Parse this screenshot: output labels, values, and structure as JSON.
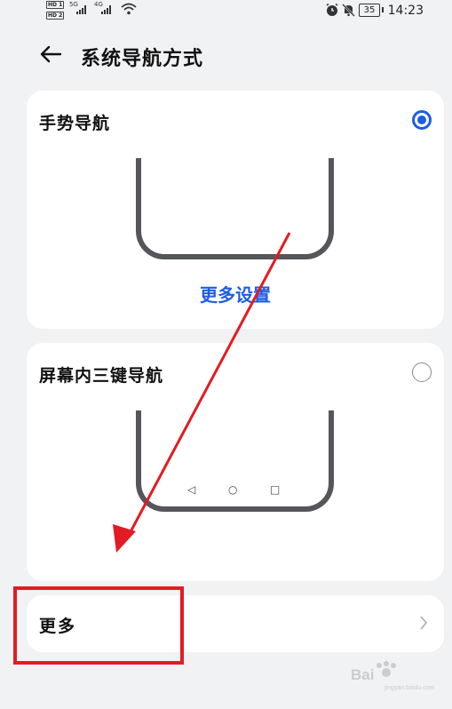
{
  "status_bar": {
    "time": "14:23",
    "battery": "35",
    "network_1": "5G",
    "network_2": "4G",
    "hd_1": "HD",
    "hd_2": "HD",
    "sim_1": "1",
    "sim_2": "2",
    "icons": [
      "signal-icon",
      "wifi-icon",
      "alarm-icon",
      "mute-icon",
      "battery-icon"
    ]
  },
  "header": {
    "title": "系统导航方式"
  },
  "options": [
    {
      "label": "手势导航",
      "selected": true,
      "link": "更多设置"
    },
    {
      "label": "屏幕内三键导航",
      "selected": false
    }
  ],
  "more": {
    "label": "更多"
  },
  "colors": {
    "accent": "#1d5de2",
    "annotation": "#e31b22",
    "background": "#f1f2f4"
  },
  "watermark": {
    "brand": "Bai",
    "sub": "jingyan.baidu.com"
  }
}
